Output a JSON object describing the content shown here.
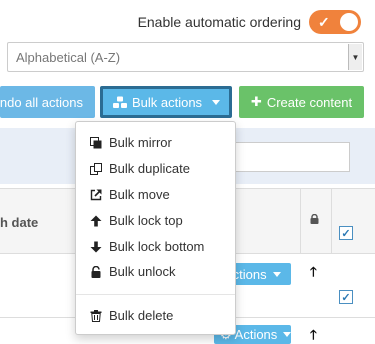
{
  "ordering": {
    "label": "Enable automatic ordering",
    "enabled": true,
    "check_glyph": "✓"
  },
  "sort_select": {
    "value": "Alphabetical (A-Z)"
  },
  "toolbar": {
    "undo_label": "ndo all actions",
    "bulk_label": "Bulk actions",
    "create_label": "Create content",
    "create_glyph": "✚"
  },
  "table": {
    "date_header": "h date",
    "row_button_label": "Actions",
    "up_glyph": "🡑"
  },
  "bulk_menu": {
    "items": [
      {
        "label": "Bulk mirror",
        "icon": "mirror-icon"
      },
      {
        "label": "Bulk duplicate",
        "icon": "duplicate-icon"
      },
      {
        "label": "Bulk move",
        "icon": "external-link-icon"
      },
      {
        "label": "Bulk lock top",
        "icon": "arrow-up-icon"
      },
      {
        "label": "Bulk lock bottom",
        "icon": "arrow-down-icon"
      },
      {
        "label": "Bulk unlock",
        "icon": "unlock-icon"
      },
      {
        "label": "Bulk delete",
        "icon": "trash-icon"
      }
    ]
  },
  "colors": {
    "toggle_on": "#f0823c",
    "primary": "#5bb8e8",
    "success": "#6ac269",
    "focus_border": "#2b6c93"
  }
}
